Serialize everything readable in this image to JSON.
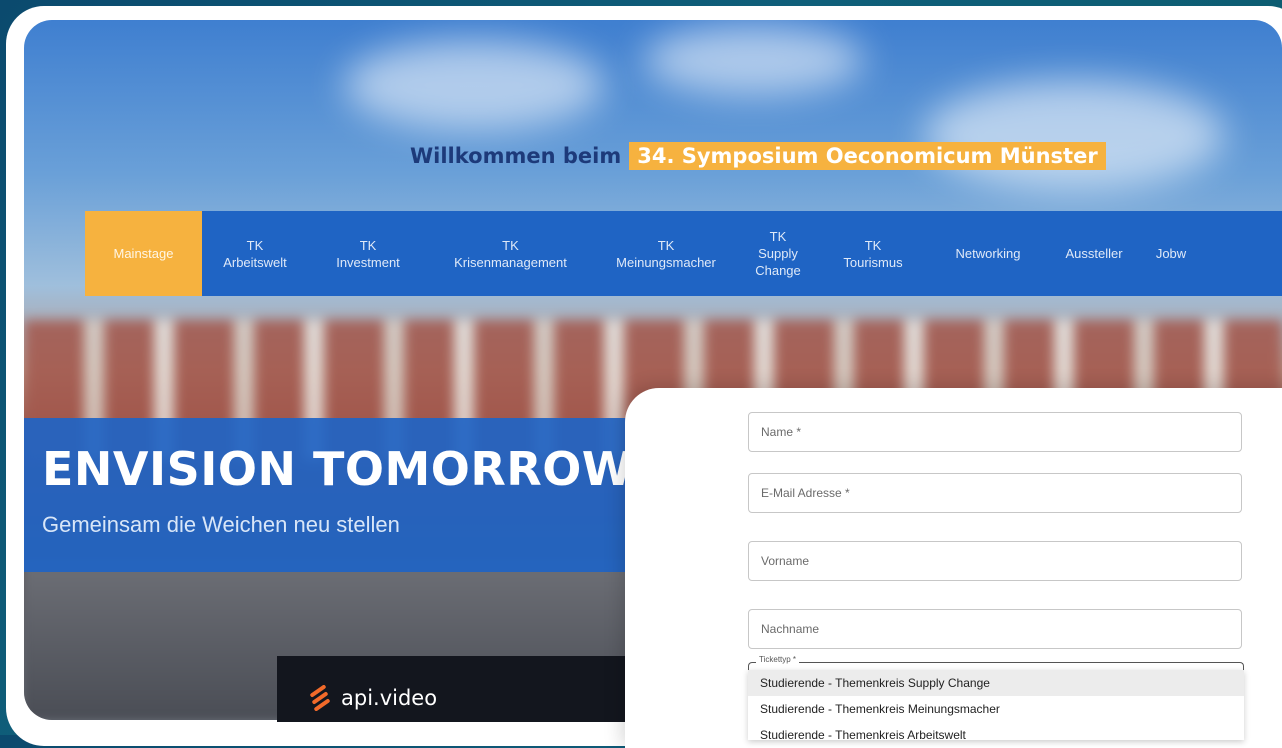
{
  "banner": {
    "welcome_text": "Willkommen beim",
    "event_name": "34. Symposium Oeconomicum Münster"
  },
  "nav": {
    "items": [
      {
        "label": "Mainstage",
        "active": true
      },
      {
        "label": "TK\nArbeitswelt"
      },
      {
        "label": "TK\nInvestment"
      },
      {
        "label": "TK\nKrisenmanagement"
      },
      {
        "label": "TK\nMeinungsmacher"
      },
      {
        "label": "TK\nSupply\nChange"
      },
      {
        "label": "TK\nTourismus"
      },
      {
        "label": "Networking"
      },
      {
        "label": "Aussteller"
      },
      {
        "label": "Jobw"
      }
    ]
  },
  "hero": {
    "title": "ENVISION TOMORROW",
    "subtitle": "Gemeinsam die Weichen neu stellen"
  },
  "player": {
    "brand": "api.video"
  },
  "form": {
    "name_placeholder": "Name *",
    "email_placeholder": "E-Mail Adresse *",
    "firstname_placeholder": "Vorname",
    "lastname_placeholder": "Nachname",
    "ticket_label": "Tickettyp *",
    "ticket_options": [
      "Studierende - Themenkreis Supply Change",
      "Studierende - Themenkreis Meinungsmacher",
      "Studierende - Themenkreis Arbeitswelt"
    ]
  },
  "colors": {
    "accent_orange": "#f6b23f",
    "nav_blue": "#1f64c4",
    "title_navy": "#1d3a7a",
    "player_dark": "#13161e"
  }
}
